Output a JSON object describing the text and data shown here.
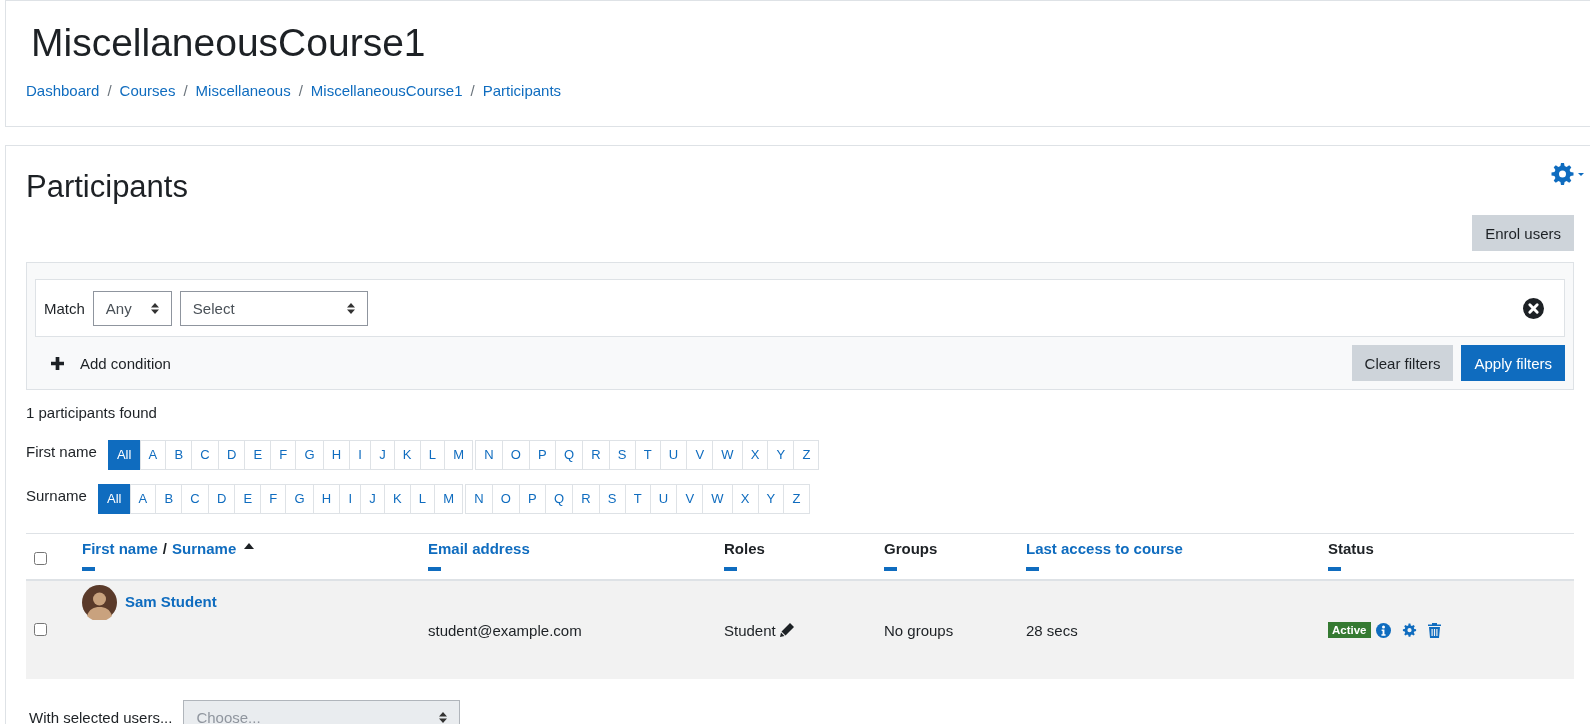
{
  "header": {
    "title": "MiscellaneousCourse1",
    "separator": "/",
    "breadcrumbs": [
      {
        "label": "Dashboard"
      },
      {
        "label": "Courses"
      },
      {
        "label": "Miscellaneous"
      },
      {
        "label": "MiscellaneousCourse1"
      },
      {
        "label": "Participants"
      }
    ]
  },
  "participants": {
    "title": "Participants",
    "enrol_button": "Enrol users",
    "filter": {
      "match_label": "Match",
      "match_value": "Any",
      "select_value": "Select",
      "add_condition": "Add condition",
      "clear_button": "Clear filters",
      "apply_button": "Apply filters"
    },
    "count": "1 participants found",
    "initials_bars": [
      {
        "label": "First name",
        "letter_groups": [
          [
            {
              "label": "All",
              "selected": true
            },
            {
              "label": "A",
              "selected": false
            },
            {
              "label": "B",
              "selected": false
            },
            {
              "label": "C",
              "selected": false
            },
            {
              "label": "D",
              "selected": false
            },
            {
              "label": "E",
              "selected": false
            },
            {
              "label": "F",
              "selected": false
            },
            {
              "label": "G",
              "selected": false
            },
            {
              "label": "H",
              "selected": false
            },
            {
              "label": "I",
              "selected": false
            },
            {
              "label": "J",
              "selected": false
            },
            {
              "label": "K",
              "selected": false
            },
            {
              "label": "L",
              "selected": false
            },
            {
              "label": "M",
              "selected": false
            }
          ],
          [
            {
              "label": "N",
              "selected": false
            },
            {
              "label": "O",
              "selected": false
            },
            {
              "label": "P",
              "selected": false
            },
            {
              "label": "Q",
              "selected": false
            },
            {
              "label": "R",
              "selected": false
            },
            {
              "label": "S",
              "selected": false
            },
            {
              "label": "T",
              "selected": false
            },
            {
              "label": "U",
              "selected": false
            },
            {
              "label": "V",
              "selected": false
            },
            {
              "label": "W",
              "selected": false
            },
            {
              "label": "X",
              "selected": false
            },
            {
              "label": "Y",
              "selected": false
            },
            {
              "label": "Z",
              "selected": false
            }
          ]
        ]
      },
      {
        "label": "Surname",
        "letter_groups": [
          [
            {
              "label": "All",
              "selected": true
            },
            {
              "label": "A",
              "selected": false
            },
            {
              "label": "B",
              "selected": false
            },
            {
              "label": "C",
              "selected": false
            },
            {
              "label": "D",
              "selected": false
            },
            {
              "label": "E",
              "selected": false
            },
            {
              "label": "F",
              "selected": false
            },
            {
              "label": "G",
              "selected": false
            },
            {
              "label": "H",
              "selected": false
            },
            {
              "label": "I",
              "selected": false
            },
            {
              "label": "J",
              "selected": false
            },
            {
              "label": "K",
              "selected": false
            },
            {
              "label": "L",
              "selected": false
            },
            {
              "label": "M",
              "selected": false
            }
          ],
          [
            {
              "label": "N",
              "selected": false
            },
            {
              "label": "O",
              "selected": false
            },
            {
              "label": "P",
              "selected": false
            },
            {
              "label": "Q",
              "selected": false
            },
            {
              "label": "R",
              "selected": false
            },
            {
              "label": "S",
              "selected": false
            },
            {
              "label": "T",
              "selected": false
            },
            {
              "label": "U",
              "selected": false
            },
            {
              "label": "V",
              "selected": false
            },
            {
              "label": "W",
              "selected": false
            },
            {
              "label": "X",
              "selected": false
            },
            {
              "label": "Y",
              "selected": false
            },
            {
              "label": "Z",
              "selected": false
            }
          ]
        ]
      }
    ],
    "table": {
      "select_all_checked": false,
      "columns": [
        {
          "label": "First name",
          "separator": "/",
          "label_2": "Surname",
          "link": true,
          "sorted": true
        },
        {
          "label": "Email address",
          "link": true,
          "sorted": false
        },
        {
          "label": "Roles",
          "link": false,
          "sorted": false
        },
        {
          "label": "Groups",
          "link": false,
          "sorted": false
        },
        {
          "label": "Last access to course",
          "link": true,
          "sorted": false
        },
        {
          "label": "Status",
          "link": false,
          "sorted": false
        }
      ],
      "rows": [
        {
          "selected": false,
          "name": "Sam Student",
          "email": "student@example.com",
          "role": "Student",
          "groups": "No groups",
          "last_access": "28 secs",
          "status": "Active"
        }
      ]
    },
    "bulk": {
      "label": "With selected users...",
      "placeholder": "Choose..."
    }
  }
}
